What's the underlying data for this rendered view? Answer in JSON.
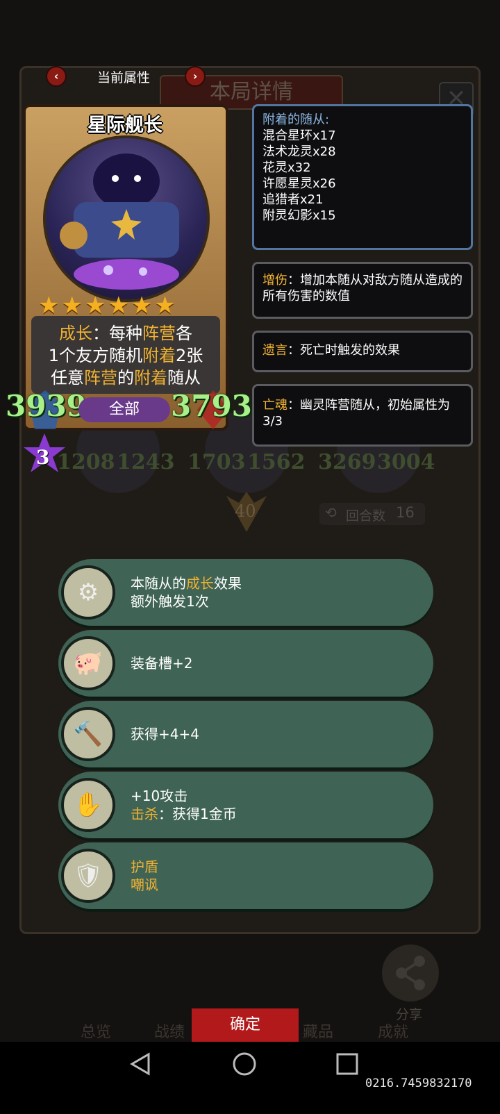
{
  "header": {
    "current_attr_label": "当前属性",
    "panel_title": "本局详情",
    "prev_arrow": "‹",
    "next_arrow": "›",
    "close": "✕"
  },
  "card": {
    "name": "星际舰长",
    "stars": 6,
    "desc": [
      [
        {
          "t": "成长",
          "k": true
        },
        {
          "t": "：每种",
          "k": false
        },
        {
          "t": "阵营",
          "k": true
        },
        {
          "t": "各",
          "k": false
        }
      ],
      [
        {
          "t": "1个友方随机",
          "k": false
        },
        {
          "t": "附着",
          "k": true
        },
        {
          "t": "2张",
          "k": false
        }
      ],
      [
        {
          "t": "任意",
          "k": false
        },
        {
          "t": "阵营",
          "k": true
        },
        {
          "t": "的",
          "k": false
        },
        {
          "t": "附着",
          "k": true
        },
        {
          "t": "随从",
          "k": false
        }
      ]
    ],
    "attack": "3939",
    "health": "3793",
    "filter_label": "全部",
    "level": "3"
  },
  "attached": {
    "title": "附着的随从:",
    "items": [
      "混合星环x17",
      "法术龙灵x28",
      "花灵x32",
      "许愿星灵x26",
      "追猎者x21",
      "附灵幻影x15"
    ]
  },
  "keywords": [
    {
      "name": "增伤",
      "text": "：增加本随从对敌方随从造成的所有伤害的数值"
    },
    {
      "name": "遗言",
      "text": "：死亡时触发的效果"
    },
    {
      "name": "亡魂",
      "text": "：幽灵阵营随从，初始属性为3/3"
    }
  ],
  "background": {
    "stats": [
      "1208",
      "1243",
      "1703",
      "1562",
      "3269",
      "3004"
    ],
    "star_value": "40",
    "turns_label": "回合数",
    "turns": "16",
    "tabs": [
      "总览",
      "战绩",
      "藏品",
      "成就"
    ],
    "share_label": "分享"
  },
  "effects": [
    {
      "icon": "hand-gear-icon",
      "glyph": "⚙",
      "lines": [
        [
          {
            "t": "本随从的",
            "k": false
          },
          {
            "t": "成长",
            "k": true
          },
          {
            "t": "效果",
            "k": false
          }
        ],
        [
          {
            "t": "额外触发1次",
            "k": false
          }
        ]
      ]
    },
    {
      "icon": "pig-icon",
      "glyph": "🐖",
      "lines": [
        [
          {
            "t": "装备槽+2",
            "k": false
          }
        ]
      ]
    },
    {
      "icon": "hammer-icon",
      "glyph": "🔨",
      "lines": [
        [
          {
            "t": "获得+4+4",
            "k": false
          }
        ]
      ]
    },
    {
      "icon": "glove-icon",
      "glyph": "✋",
      "lines": [
        [
          {
            "t": "+10攻击",
            "k": false
          }
        ],
        [
          {
            "t": "击杀",
            "k": true
          },
          {
            "t": "：获得1金币",
            "k": false
          }
        ]
      ]
    },
    {
      "icon": "shield-crest-icon",
      "glyph": "🛡",
      "lines": [
        [
          {
            "t": "护盾",
            "k": true
          }
        ],
        [
          {
            "t": "嘲讽",
            "k": true
          }
        ]
      ]
    }
  ],
  "confirm_label": "确定",
  "coordinates": "0216.7459832170",
  "colors": {
    "keyword": "#f0b232",
    "stat": "#a8f08a",
    "row": "#3f6355",
    "confirm": "#b1191a"
  }
}
